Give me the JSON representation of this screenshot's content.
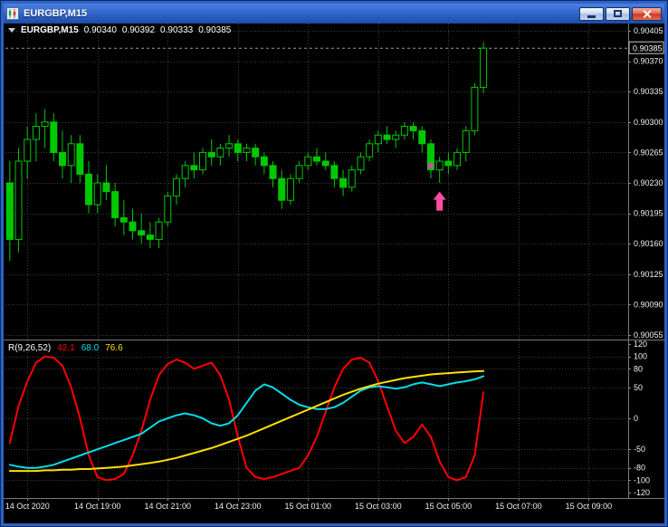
{
  "window": {
    "title": "EURGBP,M15",
    "controls": [
      "minimize",
      "maximize",
      "close"
    ]
  },
  "chart": {
    "legend": {
      "symbol": "EURGBP,M15",
      "open": "0.90340",
      "high": "0.90392",
      "low": "0.90333",
      "close": "0.90385"
    },
    "indicator_legend": {
      "name": "R(9,26,52)",
      "values": [
        "42.1",
        "68.0",
        "76.6"
      ]
    }
  },
  "chart_data": [
    {
      "type": "candlestick",
      "symbol": "EURGBP",
      "timeframe": "M15",
      "price_range": [
        0.90055,
        0.90405
      ],
      "grid_step": 0.00035,
      "y_ticks": [
        0.90405,
        0.9037,
        0.90335,
        0.903,
        0.90265,
        0.9023,
        0.90195,
        0.9016,
        0.90125,
        0.9009,
        0.90055
      ],
      "current_price": 0.90385,
      "x_labels": [
        "14 Oct 2020",
        "14 Oct 19:00",
        "14 Oct 21:00",
        "14 Oct 23:00",
        "15 Oct 01:00",
        "15 Oct 03:00",
        "15 Oct 05:00",
        "15 Oct 07:00",
        "15 Oct 09:00"
      ],
      "x_label_first_bar": 2,
      "x_label_step": 8,
      "visible_slots": 71,
      "colors": {
        "up_outline": "#00C800",
        "down_fill": "#00C800",
        "wick": "#00C800",
        "grid": "#3C3C3C",
        "axis_text": "#F0F0F0",
        "bid_line": "#9A9A9A"
      },
      "candles": [
        [
          0.9023,
          0.90255,
          0.9014,
          0.90165
        ],
        [
          0.90165,
          0.9027,
          0.9015,
          0.90255
        ],
        [
          0.90255,
          0.90295,
          0.90235,
          0.9028
        ],
        [
          0.9028,
          0.9031,
          0.90255,
          0.90295
        ],
        [
          0.90295,
          0.90315,
          0.9027,
          0.903
        ],
        [
          0.903,
          0.9031,
          0.90255,
          0.90265
        ],
        [
          0.90265,
          0.9029,
          0.90235,
          0.9025
        ],
        [
          0.9025,
          0.90285,
          0.9023,
          0.90275
        ],
        [
          0.90275,
          0.90285,
          0.9023,
          0.9024
        ],
        [
          0.9024,
          0.90255,
          0.90195,
          0.90205
        ],
        [
          0.90205,
          0.9024,
          0.90195,
          0.9023
        ],
        [
          0.9023,
          0.9025,
          0.9021,
          0.9022
        ],
        [
          0.9022,
          0.9023,
          0.9018,
          0.9019
        ],
        [
          0.9019,
          0.9021,
          0.9017,
          0.90185
        ],
        [
          0.90185,
          0.902,
          0.90165,
          0.90175
        ],
        [
          0.90175,
          0.90195,
          0.9016,
          0.9017
        ],
        [
          0.9017,
          0.90185,
          0.90155,
          0.90165
        ],
        [
          0.90165,
          0.9019,
          0.90155,
          0.90185
        ],
        [
          0.90185,
          0.9022,
          0.9018,
          0.90215
        ],
        [
          0.90215,
          0.9024,
          0.90205,
          0.90235
        ],
        [
          0.90235,
          0.90255,
          0.90225,
          0.9025
        ],
        [
          0.9025,
          0.90265,
          0.90235,
          0.90245
        ],
        [
          0.90245,
          0.9027,
          0.9024,
          0.90265
        ],
        [
          0.90265,
          0.9028,
          0.9025,
          0.9026
        ],
        [
          0.9026,
          0.90275,
          0.9025,
          0.9027
        ],
        [
          0.9027,
          0.90285,
          0.9026,
          0.90275
        ],
        [
          0.90275,
          0.9028,
          0.90255,
          0.90265
        ],
        [
          0.90265,
          0.90275,
          0.90255,
          0.9027
        ],
        [
          0.9027,
          0.90275,
          0.9025,
          0.9026
        ],
        [
          0.9026,
          0.90265,
          0.9024,
          0.9025
        ],
        [
          0.9025,
          0.90255,
          0.90225,
          0.90235
        ],
        [
          0.90235,
          0.90245,
          0.902,
          0.9021
        ],
        [
          0.9021,
          0.9024,
          0.90205,
          0.90235
        ],
        [
          0.90235,
          0.90255,
          0.9023,
          0.9025
        ],
        [
          0.9025,
          0.90265,
          0.90245,
          0.9026
        ],
        [
          0.9026,
          0.9027,
          0.9025,
          0.90255
        ],
        [
          0.90255,
          0.90265,
          0.90245,
          0.9025
        ],
        [
          0.9025,
          0.90255,
          0.90225,
          0.90235
        ],
        [
          0.90235,
          0.90245,
          0.90215,
          0.90225
        ],
        [
          0.90225,
          0.9025,
          0.9022,
          0.90245
        ],
        [
          0.90245,
          0.90265,
          0.9024,
          0.9026
        ],
        [
          0.9026,
          0.9028,
          0.90255,
          0.90275
        ],
        [
          0.90275,
          0.9029,
          0.90265,
          0.90285
        ],
        [
          0.90285,
          0.90295,
          0.90275,
          0.9028
        ],
        [
          0.9028,
          0.9029,
          0.9027,
          0.90285
        ],
        [
          0.90285,
          0.903,
          0.9028,
          0.90295
        ],
        [
          0.90295,
          0.903,
          0.9028,
          0.9029
        ],
        [
          0.9029,
          0.90295,
          0.90265,
          0.90275
        ],
        [
          0.90275,
          0.9028,
          0.90235,
          0.90245
        ],
        [
          0.90245,
          0.9026,
          0.9023,
          0.90255
        ],
        [
          0.90255,
          0.90265,
          0.9024,
          0.9025
        ],
        [
          0.9025,
          0.9027,
          0.90245,
          0.90265
        ],
        [
          0.90265,
          0.90295,
          0.90255,
          0.9029
        ],
        [
          0.9029,
          0.90345,
          0.90285,
          0.9034
        ],
        [
          0.9034,
          0.90392,
          0.90333,
          0.90385
        ]
      ],
      "markers": [
        {
          "shape": "star",
          "bar": 48,
          "price": 0.9025,
          "color": "#FF33CC"
        },
        {
          "shape": "arrow-up",
          "bar": 49,
          "price": 0.9022,
          "color": "#FF4DA6"
        }
      ]
    },
    {
      "type": "line",
      "name": "R(9,26,52)",
      "y_range": [
        -120,
        120
      ],
      "y_ticks": [
        120,
        100,
        80,
        50,
        0,
        -50,
        -80,
        -100,
        -120
      ],
      "series": [
        {
          "name": "fast",
          "color": "#FF0000",
          "width": 2,
          "values": [
            -40,
            20,
            60,
            90,
            100,
            98,
            85,
            50,
            0,
            -60,
            -95,
            -100,
            -98,
            -90,
            -60,
            -20,
            30,
            70,
            88,
            95,
            90,
            80,
            85,
            90,
            70,
            30,
            -30,
            -80,
            -95,
            -98,
            -95,
            -90,
            -85,
            -80,
            -60,
            -30,
            10,
            50,
            80,
            95,
            98,
            90,
            60,
            20,
            -20,
            -40,
            -30,
            -10,
            -30,
            -70,
            -95,
            -100,
            -95,
            -60,
            42.1
          ]
        },
        {
          "name": "mid",
          "color": "#00DDE8",
          "width": 2,
          "values": [
            -75,
            -78,
            -80,
            -80,
            -78,
            -75,
            -70,
            -65,
            -60,
            -55,
            -50,
            -45,
            -40,
            -35,
            -30,
            -25,
            -15,
            -5,
            0,
            5,
            8,
            5,
            0,
            -8,
            -12,
            -8,
            5,
            25,
            45,
            55,
            50,
            40,
            30,
            22,
            18,
            15,
            15,
            18,
            25,
            35,
            45,
            50,
            52,
            50,
            48,
            50,
            55,
            58,
            55,
            52,
            55,
            58,
            60,
            63,
            68
          ]
        },
        {
          "name": "slow",
          "color": "#FFE000",
          "width": 2,
          "values": [
            -85,
            -85,
            -85,
            -85,
            -84,
            -84,
            -83,
            -83,
            -82,
            -82,
            -81,
            -80,
            -79,
            -78,
            -76,
            -74,
            -72,
            -70,
            -67,
            -64,
            -60,
            -56,
            -52,
            -48,
            -43,
            -38,
            -33,
            -28,
            -22,
            -16,
            -10,
            -4,
            2,
            8,
            14,
            20,
            26,
            32,
            38,
            43,
            48,
            52,
            56,
            59,
            62,
            65,
            67,
            69,
            71,
            72,
            73,
            74,
            75,
            76,
            76.6
          ]
        }
      ]
    }
  ]
}
